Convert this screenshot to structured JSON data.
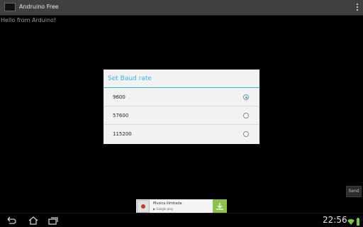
{
  "app": {
    "title": "Andruino Free",
    "icons": {
      "app": "app-icon",
      "overflow": "overflow-menu-icon"
    }
  },
  "terminal": {
    "text": "Hello from Arduino!"
  },
  "dialog": {
    "title": "Set Baud rate",
    "options": [
      {
        "label": "9600",
        "selected": true
      },
      {
        "label": "57600",
        "selected": false
      },
      {
        "label": "115200",
        "selected": false
      }
    ]
  },
  "send_button": {
    "label": "Send"
  },
  "ad": {
    "title": "Musica ilimitada",
    "subtitle": "▶ Google play",
    "icon": "download-icon"
  },
  "status_bar": {
    "time": "22:56",
    "icons": [
      "back-icon",
      "home-icon",
      "recents-icon",
      "wifi-icon",
      "battery-icon"
    ]
  },
  "colors": {
    "accent": "#33b5e5",
    "dialog_background": "#f2f2f2",
    "ad_download": "#8bc34a"
  }
}
